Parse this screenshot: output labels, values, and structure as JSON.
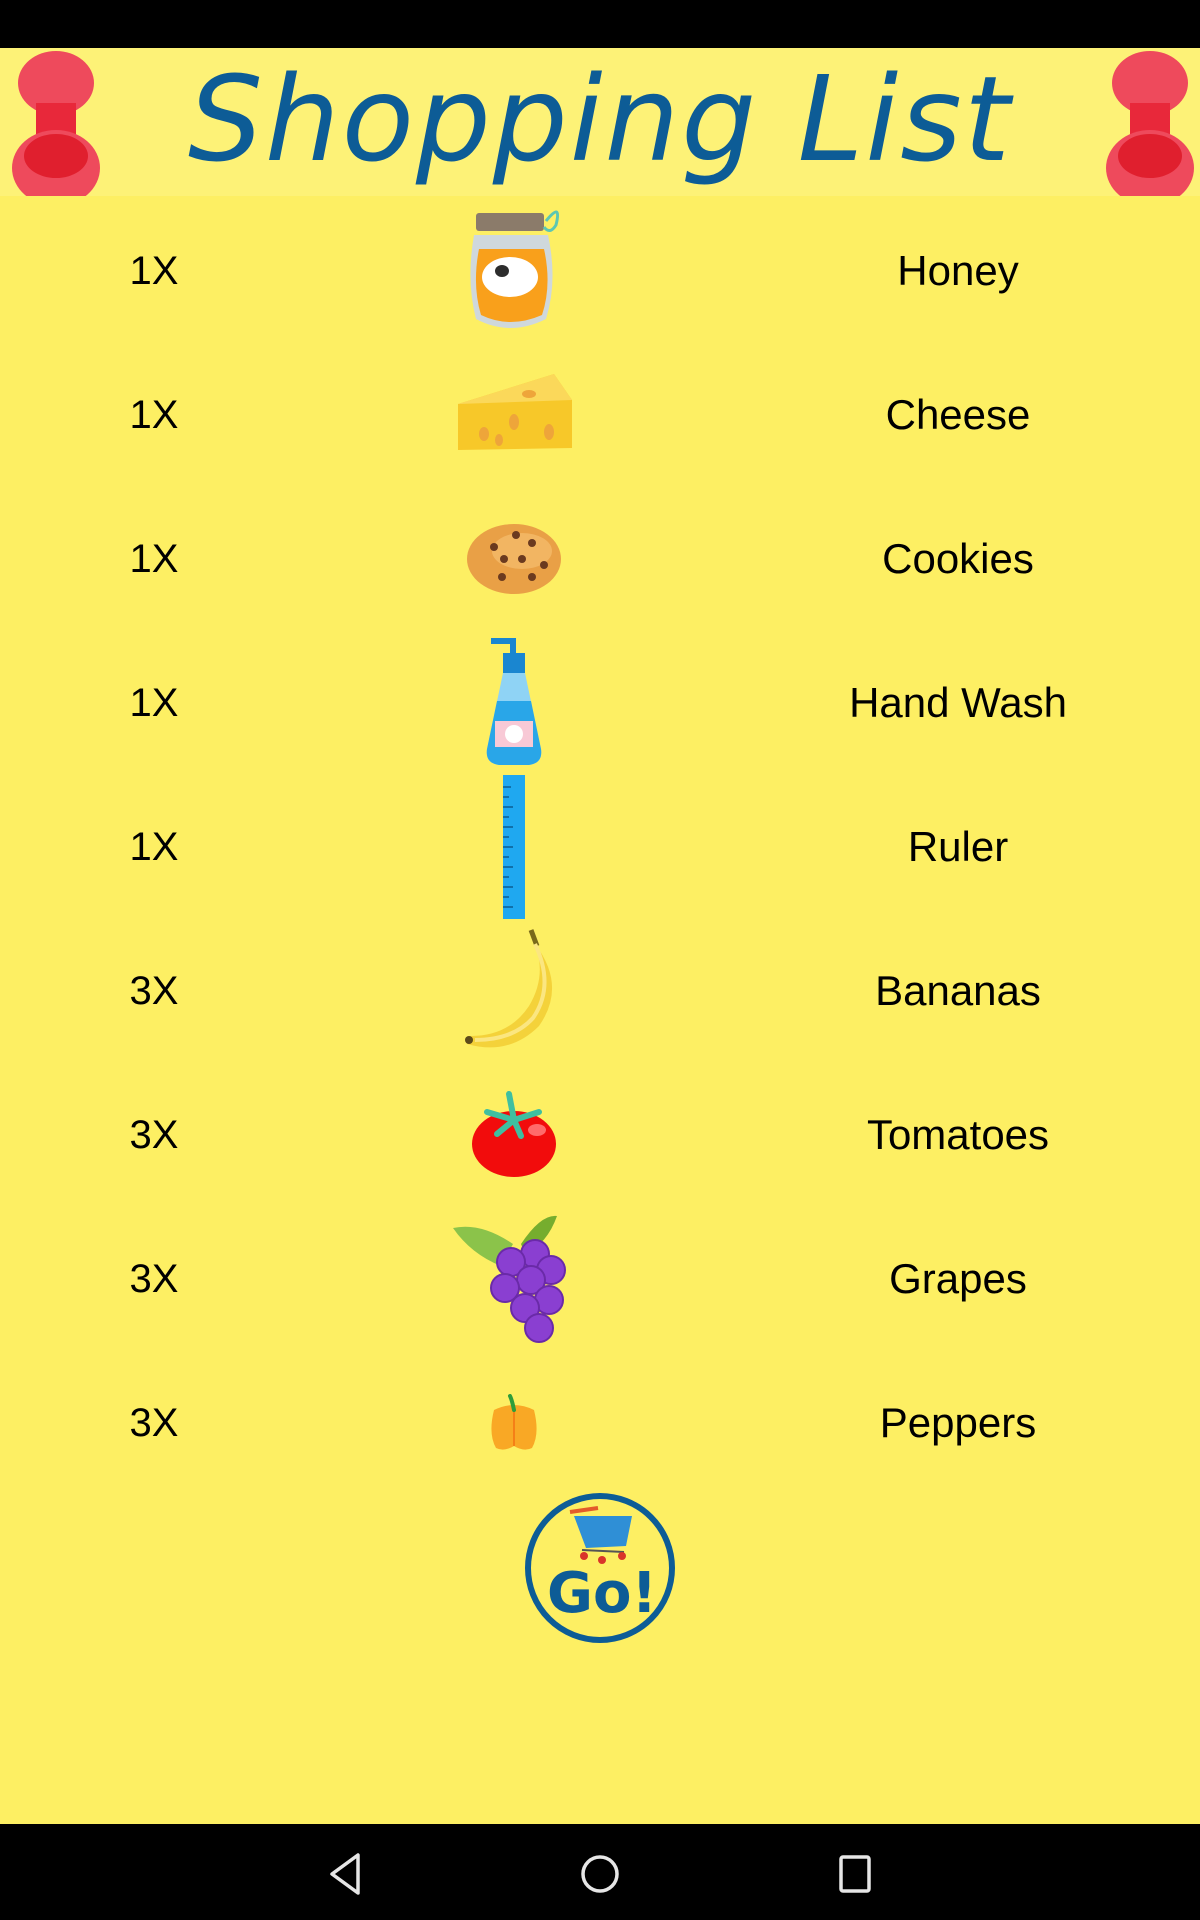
{
  "header": {
    "title": "Shopping List"
  },
  "colors": {
    "background": "#fdef63",
    "header_band": "#fdf277",
    "title": "#0d5c96",
    "pin": "#e8283a"
  },
  "items": [
    {
      "qty": "1X",
      "name": "Honey",
      "icon": "honey-jar-icon"
    },
    {
      "qty": "1X",
      "name": "Cheese",
      "icon": "cheese-icon"
    },
    {
      "qty": "1X",
      "name": "Cookies",
      "icon": "cookie-icon"
    },
    {
      "qty": "1X",
      "name": "Hand Wash",
      "icon": "hand-wash-icon"
    },
    {
      "qty": "1X",
      "name": "Ruler",
      "icon": "ruler-icon"
    },
    {
      "qty": "3X",
      "name": "Bananas",
      "icon": "banana-icon"
    },
    {
      "qty": "3X",
      "name": "Tomatoes",
      "icon": "tomato-icon"
    },
    {
      "qty": "3X",
      "name": "Grapes",
      "icon": "grapes-icon"
    },
    {
      "qty": "3X",
      "name": "Peppers",
      "icon": "pepper-icon"
    }
  ],
  "go_button": {
    "label": "Go!",
    "icon": "shopping-cart-icon"
  },
  "nav": {
    "back": "back-icon",
    "home": "home-icon",
    "recents": "recents-icon"
  }
}
